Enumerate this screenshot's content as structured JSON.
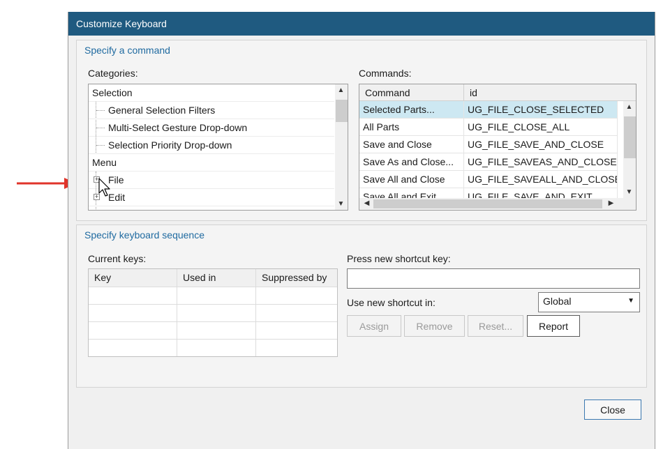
{
  "dialog": {
    "title": "Customize Keyboard"
  },
  "command_group": {
    "title": "Specify a command",
    "categories_label": "Categories:",
    "commands_label": "Commands:",
    "categories": [
      {
        "label": "Selection",
        "level": 0
      },
      {
        "label": "General Selection Filters",
        "level": 1
      },
      {
        "label": "Multi-Select Gesture Drop-down",
        "level": 1
      },
      {
        "label": "Selection Priority Drop-down",
        "level": 1
      },
      {
        "label": "Menu",
        "level": 0
      },
      {
        "label": "File",
        "level": 1,
        "expandable": true
      },
      {
        "label": "Edit",
        "level": 1,
        "expandable": true
      }
    ],
    "commands_columns": [
      "Command",
      "id"
    ],
    "commands": [
      {
        "command": "Selected Parts...",
        "id": "UG_FILE_CLOSE_SELECTED",
        "selected": true
      },
      {
        "command": "All Parts",
        "id": "UG_FILE_CLOSE_ALL"
      },
      {
        "command": "Save and Close",
        "id": "UG_FILE_SAVE_AND_CLOSE"
      },
      {
        "command": "Save As and Close...",
        "id": "UG_FILE_SAVEAS_AND_CLOSE"
      },
      {
        "command": "Save All and Close",
        "id": "UG_FILE_SAVEALL_AND_CLOSE"
      },
      {
        "command": "Save All and Exit",
        "id": "UG_FILE_SAVE_AND_EXIT"
      }
    ]
  },
  "keyboard_group": {
    "title": "Specify keyboard sequence",
    "current_keys_label": "Current keys:",
    "columns": [
      "Key",
      "Used in",
      "Suppressed by"
    ],
    "press_label": "Press new shortcut key:",
    "shortcut_value": "",
    "use_in_label": "Use new shortcut in:",
    "use_in_selected": "Global",
    "buttons": {
      "assign": "Assign",
      "remove": "Remove",
      "reset": "Reset...",
      "report": "Report"
    }
  },
  "footer": {
    "close": "Close"
  },
  "colors": {
    "titlebar": "#1f5a80",
    "group_title": "#1f6aa0",
    "selection": "#cde8f2",
    "annotation_arrow": "#e0342a"
  },
  "icons": [
    "right-arrow-annotation",
    "mouse-pointer-icon",
    "expand-plus-icon",
    "chevron-up-icon",
    "chevron-down-icon",
    "chevron-left-icon",
    "chevron-right-icon",
    "dropdown-caret-icon"
  ]
}
